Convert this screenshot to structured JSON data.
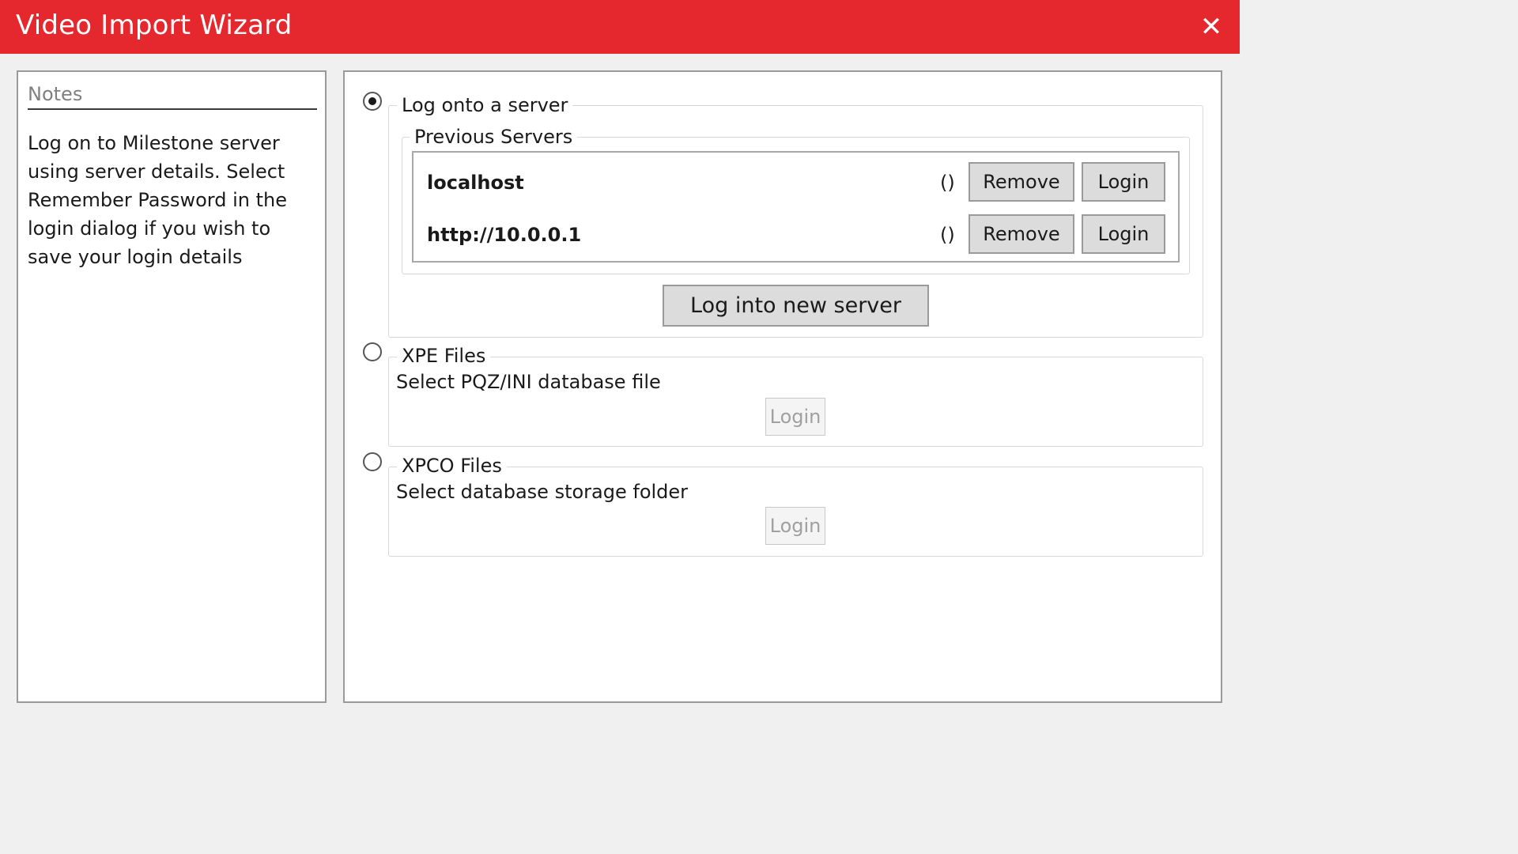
{
  "window": {
    "title": "Video Import Wizard",
    "close_icon": "close-icon"
  },
  "notes": {
    "heading": "Notes",
    "text": "Log on to Milestone server using server details. Select Remember Password in the login dialog if you wish to save your login details"
  },
  "server_option": {
    "label": "Log onto a server",
    "selected": true,
    "previous_servers": {
      "label": "Previous Servers",
      "items": [
        {
          "name": "localhost",
          "extra": "()",
          "remove_label": "Remove",
          "login_label": "Login"
        },
        {
          "name": "http://10.0.0.1",
          "extra": "()",
          "remove_label": "Remove",
          "login_label": "Login"
        }
      ]
    },
    "new_server_label": "Log into new server"
  },
  "xpe_option": {
    "label": "XPE Files",
    "selected": false,
    "description": "Select PQZ/INI database file",
    "login_label": "Login"
  },
  "xpco_option": {
    "label": "XPCO Files",
    "selected": false,
    "description": "Select database storage folder",
    "login_label": "Login"
  },
  "colors": {
    "titlebar": "#e5282e",
    "title_text": "#ffffff"
  }
}
